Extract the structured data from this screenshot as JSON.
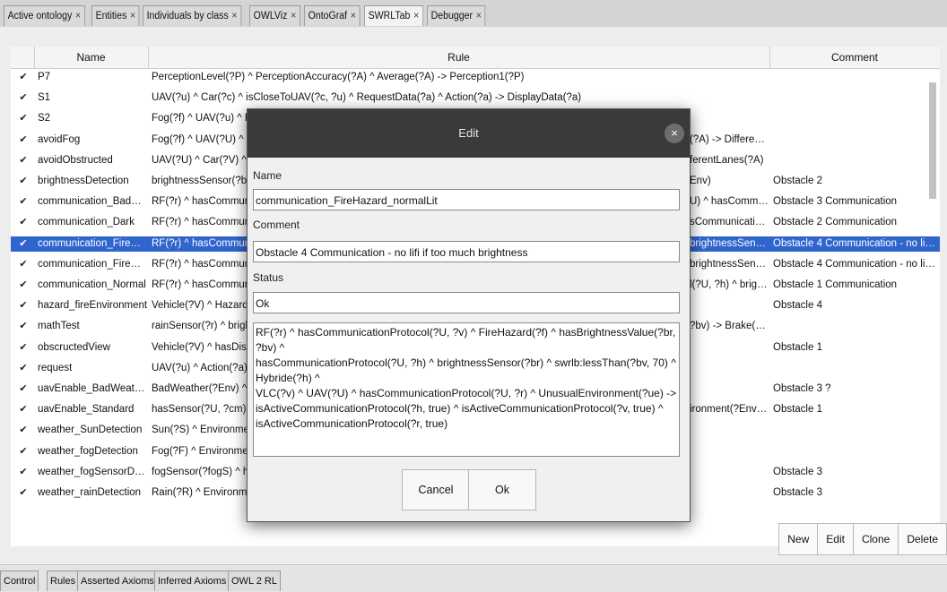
{
  "tabs": [
    "Active ontology",
    "Entities",
    "Individuals by class",
    "OWLViz",
    "OntoGraf",
    "SWRLTab",
    "Debugger"
  ],
  "table": {
    "headers": {
      "name": "Name",
      "rule": "Rule",
      "comment": "Comment"
    },
    "rows": [
      {
        "name": "P7",
        "rule": "PerceptionLevel(?P) ^ PerceptionAccuracy(?A) ^ Average(?A) -> Perception1(?P)",
        "tail": "",
        "comment": ""
      },
      {
        "name": "S1",
        "rule": "UAV(?u) ^ Car(?c) ^ isCloseToUAV(?c, ?u) ^ RequestData(?a) ^ Action(?a) -> DisplayData(?a)",
        "tail": "",
        "comment": ""
      },
      {
        "name": "S2",
        "rule": "Fog(?f) ^ UAV(?u) ^ Rad",
        "tail": "",
        "comment": ""
      },
      {
        "name": "avoidFog",
        "rule": "Fog(?f) ^ UAV(?U) ^ Ca",
        "tail": "(?A) -> DifferentL...",
        "comment": ""
      },
      {
        "name": "avoidObstructed",
        "rule": "UAV(?U) ^ Car(?V) ^ isC",
        "tail": "ferentLanes(?A)",
        "comment": ""
      },
      {
        "name": "brightnessDetection",
        "rule": "brightnessSensor(?brigh",
        "tail": "Env)",
        "comment": "Obstacle 2"
      },
      {
        "name": "communication_BadWeat...",
        "rule": "RF(?r) ^ hasCommunica",
        "tail": "U) ^ hasCommuni...",
        "comment": "Obstacle 3 Communication"
      },
      {
        "name": "communication_Dark",
        "rule": "RF(?r) ^ hasCommunica",
        "tail": "sCommunicationP...",
        "comment": "Obstacle 2 Communication"
      },
      {
        "name": "communication_FireHazar...",
        "rule": "RF(?r) ^ hasCommunica",
        "tail": "brightnessSensor...",
        "comment": "Obstacle 4 Communication - no lifi if t..."
      },
      {
        "name": "communication_FireHazar...",
        "rule": "RF(?r) ^ hasCommunica",
        "tail": "brightnessSensor...",
        "comment": "Obstacle 4 Communication - no lifi if t..."
      },
      {
        "name": "communication_Normal",
        "rule": "RF(?r) ^ hasCommunica",
        "tail": "l(?U, ?h) ^ brightn...",
        "comment": "Obstacle 1 Communication"
      },
      {
        "name": "hazard_fireEnvironment",
        "rule": "Vehicle(?V) ^ Hazard(?H",
        "tail": "",
        "comment": "Obstacle 4"
      },
      {
        "name": "mathTest",
        "rule": "rainSensor(?r) ^ brightr",
        "tail": "?bv) -> Brake(?a)",
        "comment": ""
      },
      {
        "name": "obscructedView",
        "rule": "Vehicle(?V) ^ hasDistan",
        "tail": "",
        "comment": "Obstacle 1"
      },
      {
        "name": "request",
        "rule": "UAV(?u) ^ Action(?a) ->",
        "tail": "",
        "comment": ""
      },
      {
        "name": "uavEnable_BadWeather",
        "rule": "BadWeather(?Env) ^ ua",
        "tail": "",
        "comment": "Obstacle 3 ?"
      },
      {
        "name": "uavEnable_Standard",
        "rule": "hasSensor(?U, ?cm) ^ u",
        "tail": "ironment(?Env) ->...",
        "comment": "Obstacle 1"
      },
      {
        "name": "weather_SunDetection",
        "rule": "Sun(?S) ^ Environment(",
        "tail": "",
        "comment": ""
      },
      {
        "name": "weather_fogDetection",
        "rule": "Fog(?F) ^ Environment(?",
        "tail": "",
        "comment": ""
      },
      {
        "name": "weather_fogSensorDetec...",
        "rule": "fogSensor(?fogS) ^ has",
        "tail": "",
        "comment": "Obstacle 3"
      },
      {
        "name": "weather_rainDetection",
        "rule": "Rain(?R) ^ Environment(",
        "tail": "",
        "comment": "Obstacle 3"
      }
    ],
    "selected_index": 8,
    "check_glyph": "✔"
  },
  "table_buttons": [
    "New",
    "Edit",
    "Clone",
    "Delete"
  ],
  "bottom_tabs": [
    "Control",
    "Rules",
    "Asserted Axioms",
    "Inferred Axioms",
    "OWL 2 RL"
  ],
  "dialog": {
    "title": "Edit",
    "close_glyph": "×",
    "name_label": "Name",
    "name_value": "communication_FireHazard_normalLit",
    "comment_label": "Comment",
    "comment_value": "Obstacle 4 Communication - no lifi if too much brightness",
    "status_label": "Status",
    "status_value": "Ok",
    "rule_text": "RF(?r) ^ hasCommunicationProtocol(?U, ?v) ^ FireHazard(?f) ^ hasBrightnessValue(?br, ?bv) ^\nhasCommunicationProtocol(?U, ?h) ^ brightnessSensor(?br) ^ swrlb:lessThan(?bv, 70) ^ Hybride(?h) ^\nVLC(?v) ^ UAV(?U) ^ hasCommunicationProtocol(?U, ?r) ^ UnusualEnvironment(?ue) ->\nisActiveCommunicationProtocol(?h, true) ^ isActiveCommunicationProtocol(?v, true) ^\nisActiveCommunicationProtocol(?r, true)",
    "cancel_label": "Cancel",
    "ok_label": "Ok"
  }
}
